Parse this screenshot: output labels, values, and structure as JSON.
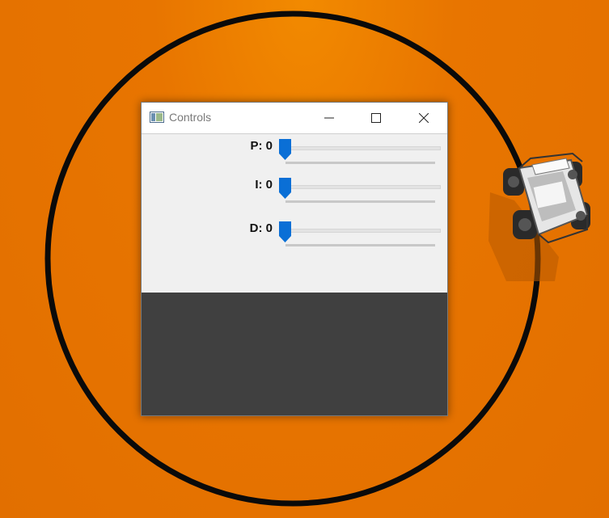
{
  "window": {
    "title": "Controls",
    "icon": "app-window-icon"
  },
  "titlebar_buttons": {
    "minimize": "minimize-icon",
    "maximize": "maximize-icon",
    "close": "close-icon"
  },
  "controls": [
    {
      "label": "P: 0",
      "value": 0
    },
    {
      "label": "I: 0",
      "value": 0
    },
    {
      "label": "D: 0",
      "value": 0
    }
  ],
  "colors": {
    "background": "#e57200",
    "track_line": "#0a0a0a",
    "slider_thumb": "#0a6fd6",
    "dark_pane": "#404040",
    "window_body": "#f0f0f0"
  }
}
